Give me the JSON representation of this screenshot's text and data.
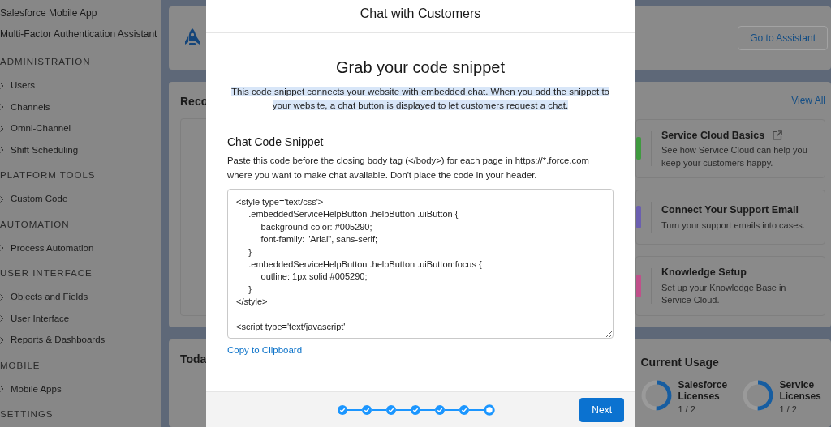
{
  "sidebar": {
    "items": [
      {
        "label": "Salesforce Mobile App"
      },
      {
        "label": "Multi-Factor Authentication Assistant"
      }
    ],
    "sections": [
      {
        "heading": "ADMINISTRATION",
        "items": [
          "Users",
          "Channels",
          "Omni-Channel",
          "Shift Scheduling"
        ]
      },
      {
        "heading": "PLATFORM TOOLS",
        "items": [
          "Custom Code"
        ]
      },
      {
        "heading": "AUTOMATION",
        "items": [
          "Process Automation"
        ]
      },
      {
        "heading": "USER INTERFACE",
        "items": [
          "Objects and Fields",
          "User Interface",
          "Reports & Dashboards"
        ]
      },
      {
        "heading": "MOBILE",
        "items": [
          "Mobile Apps"
        ]
      },
      {
        "heading": "SETTINGS"
      }
    ]
  },
  "assistant_card": {
    "button": "Go to Assistant"
  },
  "recommended_card": {
    "title": "Reco",
    "view_all": "View All",
    "items": [
      {
        "title": "Service Cloud Basics",
        "description": "See how Service Cloud can help you keep your customers happy.",
        "external": true,
        "color": "#3f9a3f"
      },
      {
        "title": "Connect Your Support Email",
        "description": "Turn your support emails into cases.",
        "external": false,
        "color": "#6b5fb0"
      },
      {
        "title": "Knowledge Setup",
        "description": "Set up your Knowledge Base in Service Cloud.",
        "external": false,
        "color": "#c0508a"
      }
    ]
  },
  "today_card": {
    "title": "Toda"
  },
  "usage_card": {
    "title": "Current Usage",
    "items": [
      {
        "label": "Salesforce Licenses",
        "count": "1 / 2",
        "level": 0.5
      },
      {
        "label": "Service Licenses",
        "count": "1 / 2",
        "level": 0.5
      }
    ]
  },
  "modal": {
    "title": "Chat with Customers",
    "heading": "Grab your code snippet",
    "intro": "This code snippet connects your website with embedded chat. When you add the snippet to your website, a chat button is displayed to let customers request a chat.",
    "section_title": "Chat Code Snippet",
    "instructions": "Paste this code before the closing body tag (</body>) for each page in https://*.force.com where you want to make chat available. Don't place the code in your header.",
    "code": "<style type='text/css'>\n\t.embeddedServiceHelpButton .helpButton .uiButton {\n\t\tbackground-color: #005290;\n\t\tfont-family: \"Arial\", sans-serif;\n\t}\n\t.embeddedServiceHelpButton .helpButton .uiButton:focus {\n\t\toutline: 1px solid #005290;\n\t}\n</style>\n\n<script type='text/javascript'",
    "copy_link": "Copy to Clipboard",
    "steps": [
      {
        "completed": true
      },
      {
        "completed": true
      },
      {
        "completed": true
      },
      {
        "completed": true
      },
      {
        "completed": true
      },
      {
        "completed": true
      },
      {
        "completed": false
      }
    ],
    "next_button": "Next"
  }
}
